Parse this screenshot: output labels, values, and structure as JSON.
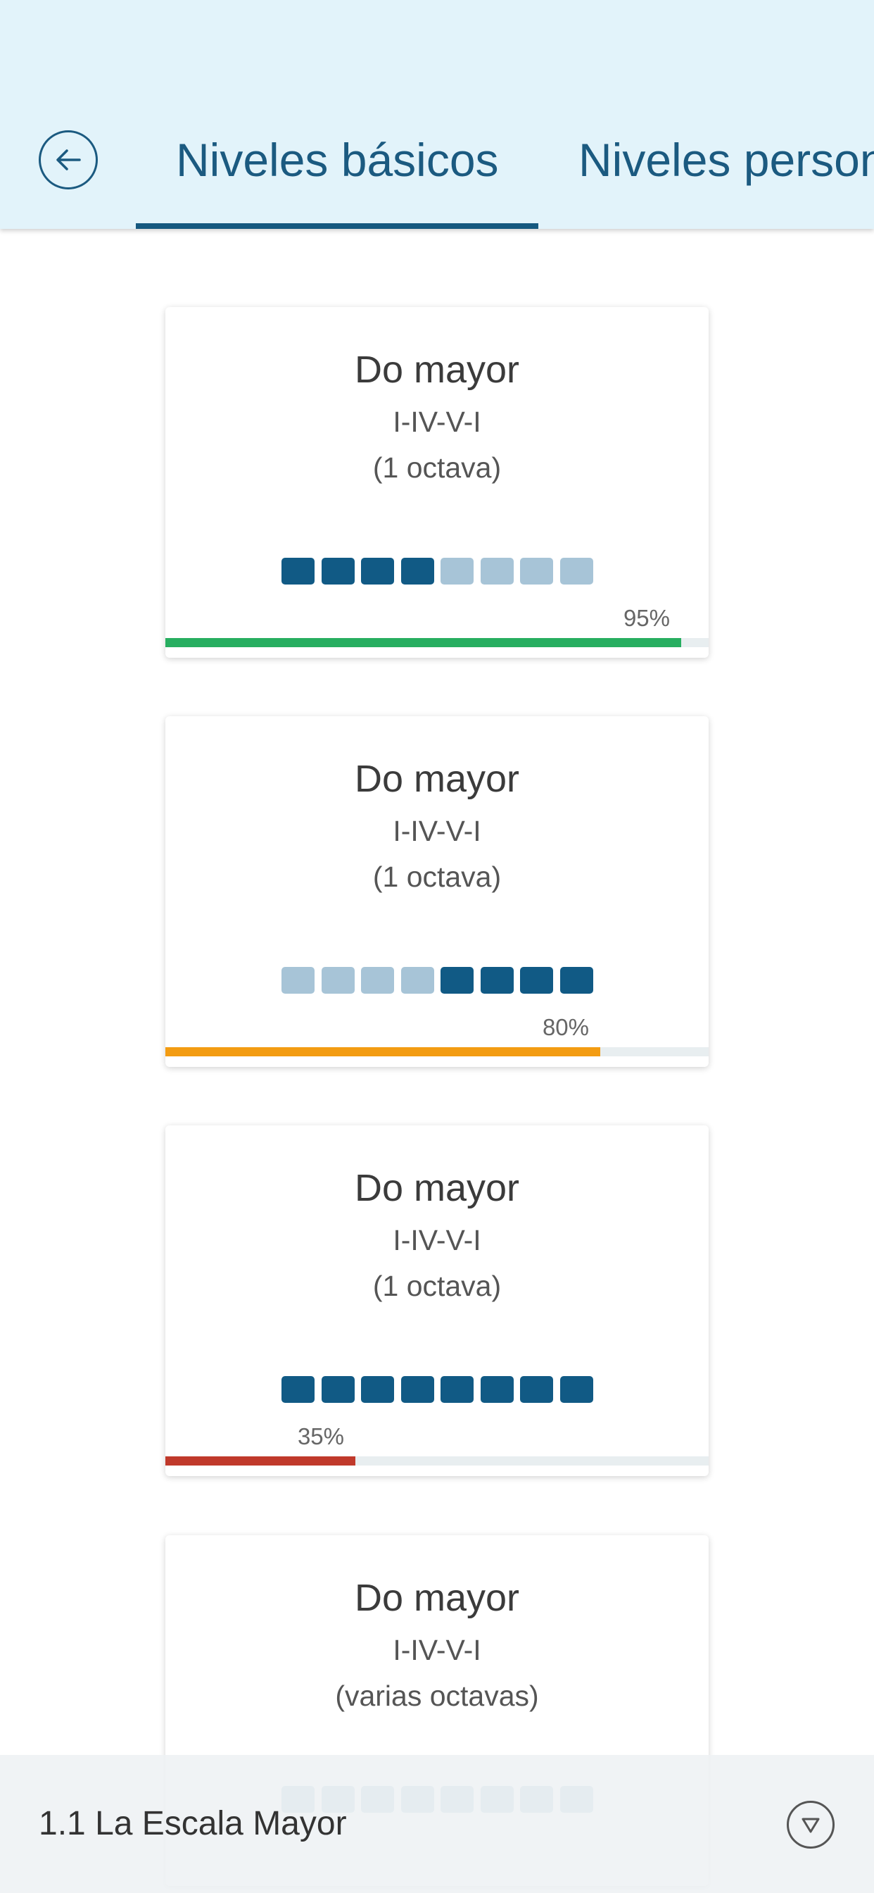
{
  "header": {
    "back_icon": "arrow-left-circle-icon",
    "tabs": [
      {
        "label": "Niveles básicos",
        "active": true
      },
      {
        "label": "Niveles personalizados",
        "active": false
      }
    ],
    "accent_color": "#15587f",
    "background_color": "#e2f3fa"
  },
  "levels": [
    {
      "title": "Do mayor",
      "progression": "I-IV-V-I",
      "octaves": "(1 octava)",
      "squares": [
        1,
        1,
        1,
        1,
        0,
        0,
        0,
        0
      ],
      "percent_label": "95%",
      "progress": 0.95,
      "bar_color": "#27ae60"
    },
    {
      "title": "Do mayor",
      "progression": "I-IV-V-I",
      "octaves": "(1 octava)",
      "squares": [
        0,
        0,
        0,
        0,
        1,
        1,
        1,
        1
      ],
      "percent_label": "80%",
      "progress": 0.8,
      "bar_color": "#f39c12"
    },
    {
      "title": "Do mayor",
      "progression": "I-IV-V-I",
      "octaves": "(1 octava)",
      "squares": [
        1,
        1,
        1,
        1,
        1,
        1,
        1,
        1
      ],
      "percent_label": "35%",
      "progress": 0.35,
      "bar_color": "#c0392b"
    },
    {
      "title": "Do mayor",
      "progression": "I-IV-V-I",
      "octaves": "(varias octavas)",
      "squares": [
        0,
        0,
        0,
        0,
        0,
        0,
        0,
        0
      ],
      "percent_label": "",
      "progress": 0,
      "bar_color": ""
    }
  ],
  "footer": {
    "label": "1.1 La Escala Mayor",
    "dropdown_icon": "triangle-down-circle-icon"
  }
}
